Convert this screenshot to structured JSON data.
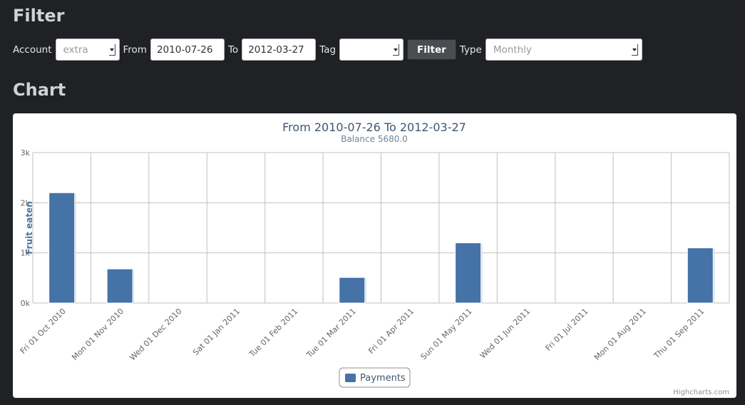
{
  "sections": {
    "filter_title": "Filter",
    "chart_title": "Chart"
  },
  "filter": {
    "account_label": "Account",
    "account_value": "extra",
    "from_label": "From",
    "from_value": "2010-07-26",
    "to_label": "To",
    "to_value": "2012-03-27",
    "tag_label": "Tag",
    "tag_value": "",
    "filter_button": "Filter",
    "type_label": "Type",
    "type_value": "Monthly"
  },
  "chart_data": {
    "type": "bar",
    "title": "From 2010-07-26 To 2012-03-27",
    "subtitle": "Balance 5680.0",
    "ylabel": "Fruit eaten",
    "xlabel": "",
    "ylim": [
      0,
      3000
    ],
    "yticks": [
      0,
      1000,
      2000,
      3000
    ],
    "ytick_labels": [
      "0k",
      "1k",
      "2k",
      "3k"
    ],
    "categories": [
      "Fri 01 Oct 2010",
      "Mon 01 Nov 2010",
      "Wed 01 Dec 2010",
      "Sat 01 Jan 2011",
      "Tue 01 Feb 2011",
      "Tue 01 Mar 2011",
      "Fri 01 Apr 2011",
      "Sun 01 May 2011",
      "Wed 01 Jun 2011",
      "Fri 01 Jul 2011",
      "Mon 01 Aug 2011",
      "Thu 01 Sep 2011"
    ],
    "series": [
      {
        "name": "Payments",
        "color": "#4572a7",
        "values": [
          2200,
          680,
          0,
          0,
          0,
          510,
          0,
          1200,
          0,
          0,
          0,
          1100
        ]
      }
    ],
    "grid": true,
    "legend": "bottom-center",
    "credits": "Highcharts.com"
  }
}
